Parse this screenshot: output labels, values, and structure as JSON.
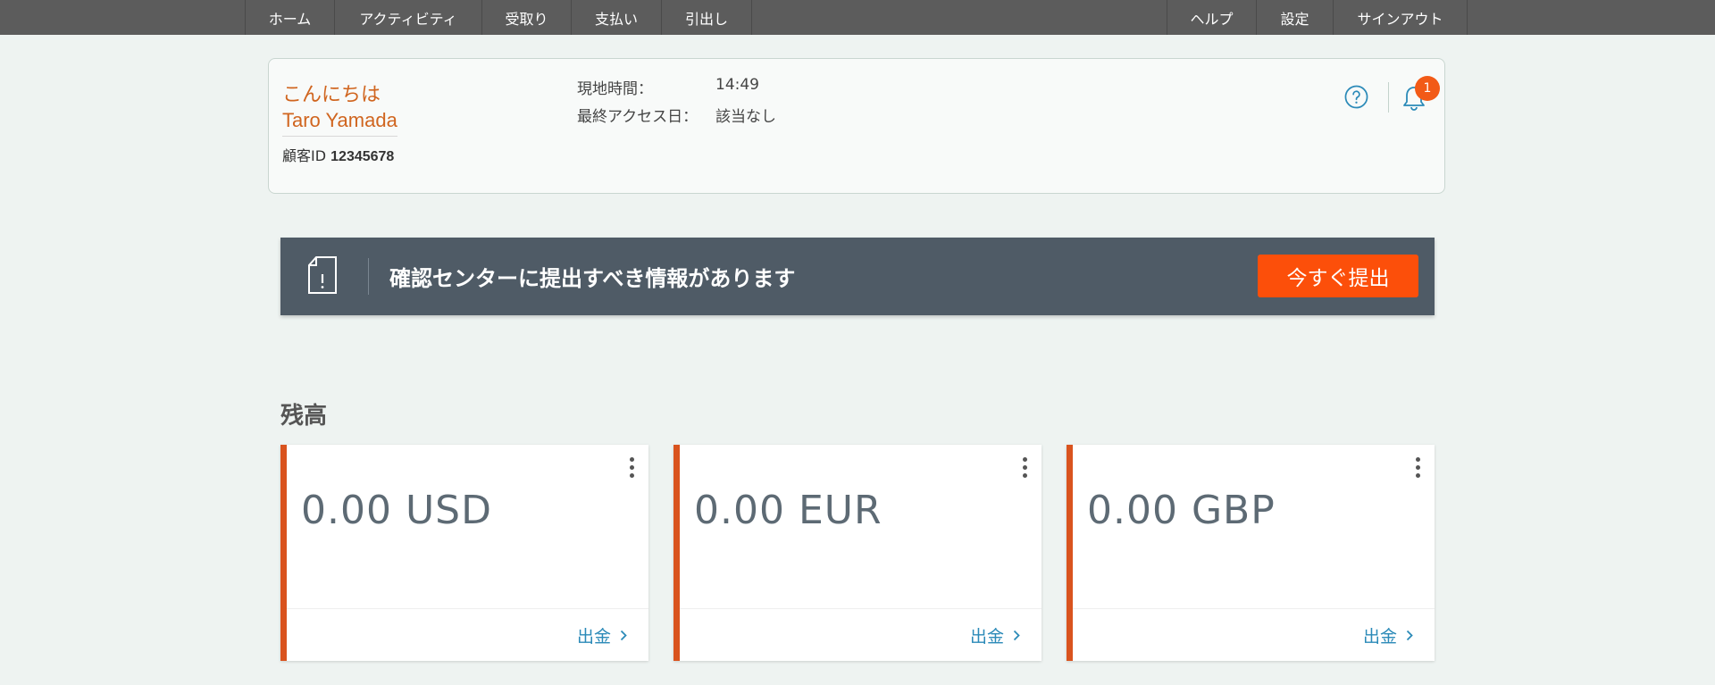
{
  "nav": {
    "left": [
      "ホーム",
      "アクティビティ",
      "受取り",
      "支払い",
      "引出し"
    ],
    "right": [
      "ヘルプ",
      "設定",
      "サインアウト"
    ]
  },
  "greeting": {
    "hello": "こんにちは",
    "name": "Taro Yamada",
    "customer_id_label": "顧客ID",
    "customer_id": "12345678",
    "local_time_label": "現地時間：",
    "local_time": "14:49",
    "last_access_label": "最終アクセス日：",
    "last_access": "該当なし",
    "notification_count": "1"
  },
  "banner": {
    "message": "確認センターに提出すべき情報があります",
    "button": "今すぐ提出"
  },
  "balances": {
    "title": "残高",
    "cards": [
      {
        "amount": "0.00 USD",
        "action": "出金"
      },
      {
        "amount": "0.00 EUR",
        "action": "出金"
      },
      {
        "amount": "0.00 GBP",
        "action": "出金"
      }
    ]
  },
  "colors": {
    "accent_orange": "#d0651f",
    "button_orange": "#fc4f0a",
    "banner_bg": "#4f5b66",
    "link_blue": "#2b8ab8"
  }
}
